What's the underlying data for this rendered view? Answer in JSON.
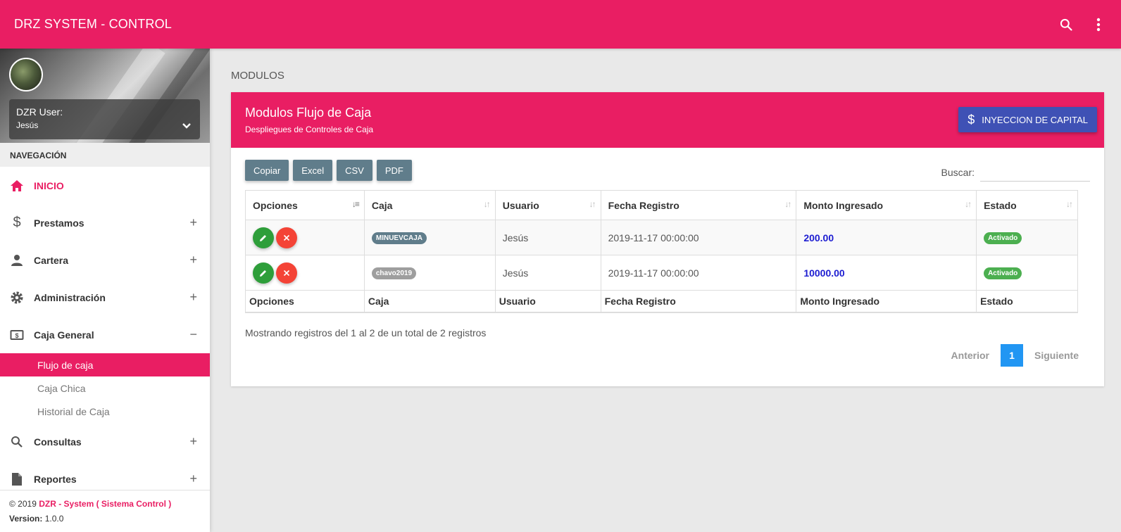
{
  "topbar": {
    "title": "DRZ SYSTEM - CONTROL",
    "search_icon": "search-icon",
    "more_icon": "more-vert-icon"
  },
  "sidebar": {
    "user": {
      "name_label": "DZR User:",
      "name_value": "Jesús"
    },
    "nav_header": "NAVEGACIÓN",
    "items": [
      {
        "label": "INICIO",
        "icon": "home-icon",
        "active": true
      },
      {
        "label": "Prestamos",
        "icon": "dollar-icon",
        "toggle": "+"
      },
      {
        "label": "Cartera",
        "icon": "person-icon",
        "toggle": "+"
      },
      {
        "label": "Administración",
        "icon": "gear-icon",
        "toggle": "+"
      },
      {
        "label": "Caja General",
        "icon": "cash-icon",
        "toggle": "−"
      },
      {
        "label": "Consultas",
        "icon": "search-icon",
        "toggle": "+"
      },
      {
        "label": "Reportes",
        "icon": "document-icon",
        "toggle": "+"
      }
    ],
    "subitems": [
      {
        "label": "Flujo de caja",
        "active": true
      },
      {
        "label": "Caja Chica"
      },
      {
        "label": "Historial de Caja"
      }
    ],
    "legal": {
      "copyright": "© 2019 ",
      "brand": "DZR - System ( Sistema Control )",
      "version_label": "Version:",
      "version": " 1.0.0"
    }
  },
  "main": {
    "block_header": "MODULOS",
    "card": {
      "title": "Modulos Flujo de Caja",
      "subtitle": "Despliegues de Controles de Caja",
      "capital_button": "INYECCION DE CAPITAL"
    },
    "export_buttons": [
      "Copiar",
      "Excel",
      "CSV",
      "PDF"
    ],
    "search": {
      "label": "Buscar:",
      "value": ""
    },
    "table": {
      "headers": [
        "Opciones",
        "Caja",
        "Usuario",
        "Fecha Registro",
        "Monto Ingresado",
        "Estado"
      ],
      "rows": [
        {
          "caja": "MINUEVCAJA",
          "usuario": "Jesús",
          "fecha": "2019-11-17 00:00:00",
          "monto": "200.00",
          "estado": "Activado"
        },
        {
          "caja": "chavo2019",
          "usuario": "Jesús",
          "fecha": "2019-11-17 00:00:00",
          "monto": "10000.00",
          "estado": "Activado"
        }
      ]
    },
    "info": "Mostrando registros del 1 al 2 de un total de 2 registros",
    "pagination": {
      "prev": "Anterior",
      "current": "1",
      "next": "Siguiente"
    }
  },
  "colors": {
    "primary": "#e91e63",
    "indigo": "#3f51b5",
    "blue_grey": "#607d8b",
    "green": "#4caf50",
    "red": "#f44336"
  }
}
